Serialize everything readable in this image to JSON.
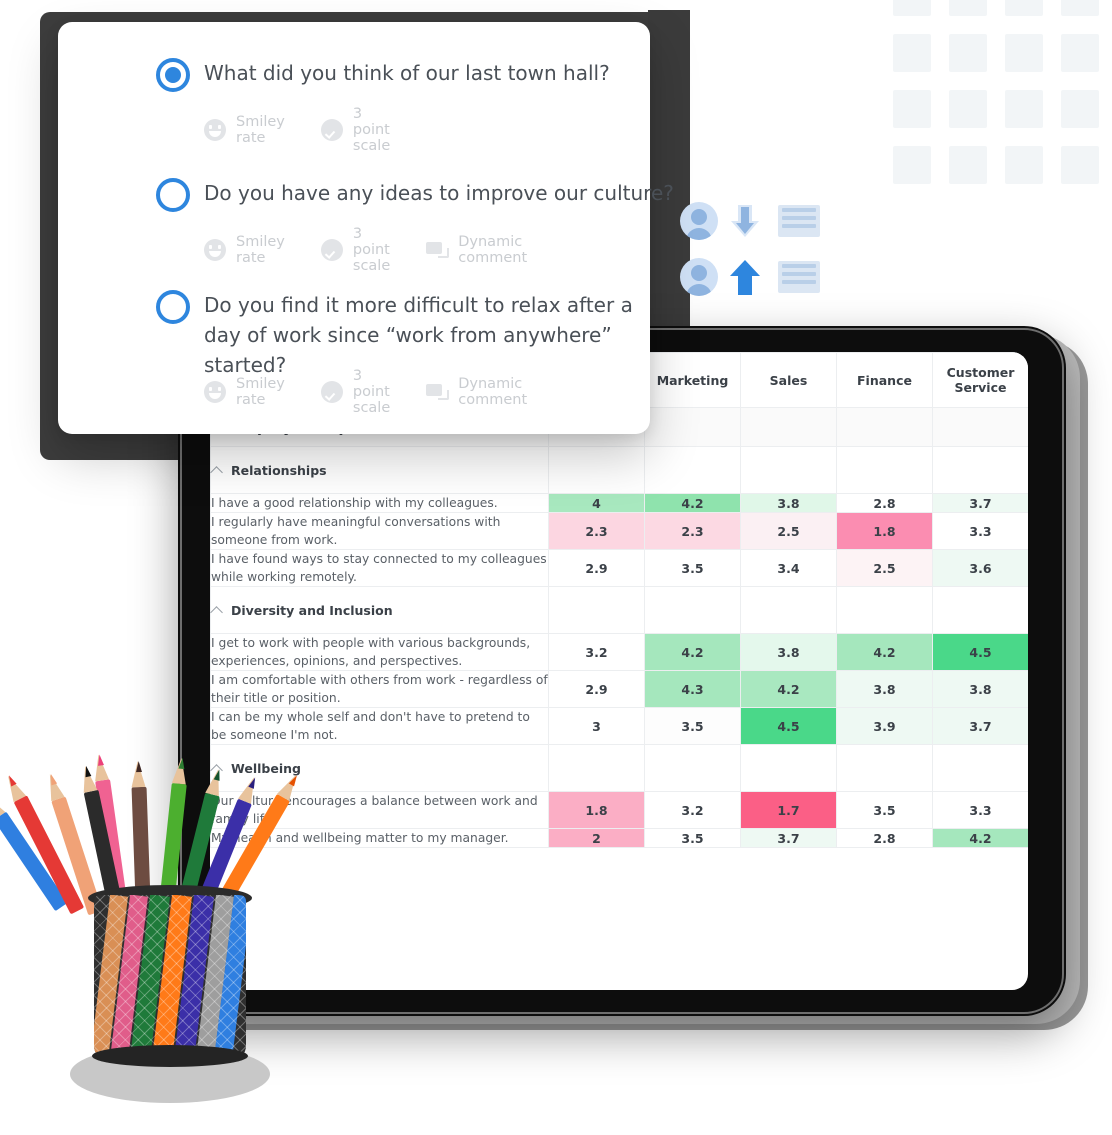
{
  "survey_card": {
    "questions": [
      {
        "text": "What did you think of our last town hall?",
        "selected": true,
        "tags": [
          {
            "icon": "smiley-icon",
            "label": "Smiley rate"
          },
          {
            "icon": "check-circle-icon",
            "label": "3 point scale"
          }
        ]
      },
      {
        "text": "Do you have any ideas to improve our culture?",
        "selected": false,
        "tags": [
          {
            "icon": "smiley-icon",
            "label": "Smiley rate"
          },
          {
            "icon": "check-circle-icon",
            "label": "3 point scale"
          },
          {
            "icon": "comment-icon",
            "label": "Dynamic comment"
          }
        ]
      },
      {
        "text": "Do you find it more difficult to relax after a day of work since “work from anywhere” started?",
        "selected": false,
        "tags": [
          {
            "icon": "smiley-icon",
            "label": "Smiley rate"
          },
          {
            "icon": "check-circle-icon",
            "label": "3 point scale"
          },
          {
            "icon": "comment-icon",
            "label": "Dynamic comment"
          }
        ]
      }
    ]
  },
  "colors": {
    "accent_blue": "#2e86de",
    "tag_grey": "#c9ccd0",
    "heat_green_strong": "#3ed37d",
    "heat_green_mid": "#a8e8bf",
    "heat_green_light": "#ddf5e5",
    "heat_green_faint": "#eef9f2",
    "heat_pink_strong": "#fb6f92",
    "heat_pink_mid": "#fba8c0",
    "heat_pink_light": "#fcd9e3",
    "heat_pink_faint": "#fbeef1",
    "neutral": "#ffffff"
  },
  "chart_data": {
    "type": "heatmap",
    "title": "Employee Experience",
    "columns": [
      "Marketing",
      "Sales",
      "Finance",
      "Customer Service"
    ],
    "hidden_first_column": true,
    "groups": [
      {
        "name": "Relationships",
        "rows": [
          {
            "question": "I have a good relationship with my colleagues.",
            "values": [
              "4",
              "4.2",
              "3.8",
              "2.8",
              "3.7"
            ],
            "shades": [
              "green-mid",
              "green-strong2",
              "green-light",
              "white",
              "green-faint"
            ]
          },
          {
            "question": "I regularly have meaningful conversations with someone from work.",
            "values": [
              "2.3",
              "2.3",
              "2.5",
              "1.8",
              "3.3"
            ],
            "shades": [
              "pink-light",
              "pink-light",
              "pink-faint",
              "pink-strong",
              "white"
            ]
          },
          {
            "question": "I have found ways to stay connected to my colleagues while working remotely.",
            "values": [
              "2.9",
              "3.5",
              "3.4",
              "2.5",
              "3.6"
            ],
            "shades": [
              "white",
              "white",
              "white",
              "pink-faint",
              "green-faint"
            ]
          }
        ]
      },
      {
        "name": "Diversity and Inclusion",
        "rows": [
          {
            "question": "I get to work with people with various backgrounds, experiences, opinions, and perspectives.",
            "values": [
              "3.2",
              "4.2",
              "3.8",
              "4.2",
              "4.5"
            ],
            "shades": [
              "white",
              "green-mid",
              "green-light",
              "green-mid",
              "green-strong"
            ]
          },
          {
            "question": "I am comfortable with others from work - regardless of their title or position.",
            "values": [
              "2.9",
              "4.3",
              "4.2",
              "3.8",
              "3.8"
            ],
            "shades": [
              "white",
              "green-mid",
              "green-mid",
              "green-faint",
              "green-faint"
            ]
          },
          {
            "question": "I can be my whole self and don't have to pretend to be someone I'm not.",
            "values": [
              "3",
              "3.5",
              "4.5",
              "3.9",
              "3.7"
            ],
            "shades": [
              "white",
              "white",
              "green-strong",
              "green-faint",
              "green-faint"
            ]
          }
        ]
      },
      {
        "name": "Wellbeing",
        "rows": [
          {
            "question": "Our culture encourages a balance between work and family life.",
            "values": [
              "1.8",
              "3.2",
              "1.7",
              "3.5",
              "3.3"
            ],
            "shades": [
              "pink-mid",
              "white",
              "pink-strong",
              "white",
              "white"
            ]
          },
          {
            "question": "My health and wellbeing matter to my manager.",
            "values": [
              "2",
              "3.5",
              "3.7",
              "2.8",
              "4.2"
            ],
            "shades": [
              "pink-mid",
              "white",
              "green-faint",
              "white",
              "green-mid"
            ]
          }
        ]
      }
    ]
  }
}
